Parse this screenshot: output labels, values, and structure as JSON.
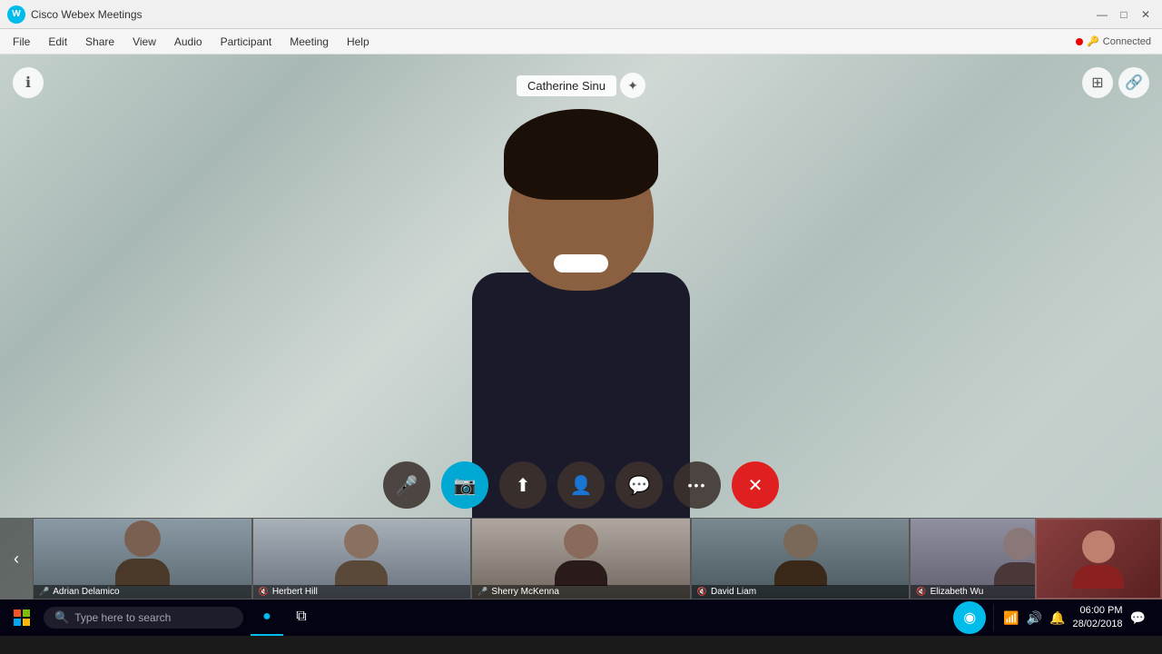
{
  "app": {
    "title": "Cisco Webex Meetings",
    "connection_status": "Connected",
    "connection_dot_color": "#e00000"
  },
  "menu": {
    "items": [
      "File",
      "Edit",
      "Share",
      "View",
      "Audio",
      "Participant",
      "Meeting",
      "Help"
    ]
  },
  "presenter": {
    "name": "Catherine Sinu"
  },
  "controls": [
    {
      "id": "mute",
      "icon": "🎤",
      "style": "dark",
      "label": "Mute"
    },
    {
      "id": "video",
      "icon": "📷",
      "style": "blue",
      "label": "Video"
    },
    {
      "id": "share",
      "icon": "⬆",
      "style": "dark",
      "label": "Share"
    },
    {
      "id": "participants",
      "icon": "👤",
      "style": "dark",
      "label": "Participants"
    },
    {
      "id": "chat",
      "icon": "💬",
      "style": "dark",
      "label": "Chat"
    },
    {
      "id": "more",
      "icon": "•••",
      "style": "dark",
      "label": "More"
    },
    {
      "id": "end",
      "icon": "✕",
      "style": "end",
      "label": "End"
    }
  ],
  "participants": [
    {
      "name": "Adrian Delamico",
      "mic": "on",
      "tile_class": "tile1"
    },
    {
      "name": "Herbert Hill",
      "mic": "off",
      "tile_class": "tile2"
    },
    {
      "name": "Sherry McKenna",
      "mic": "on",
      "tile_class": "tile3"
    },
    {
      "name": "David Liam",
      "mic": "off",
      "tile_class": "tile4"
    },
    {
      "name": "Elizabeth Wu",
      "mic": "off",
      "tile_class": "tile5"
    }
  ],
  "taskbar": {
    "search_placeholder": "Type here to search",
    "time": "06:00 PM",
    "date": "28/02/2018"
  }
}
